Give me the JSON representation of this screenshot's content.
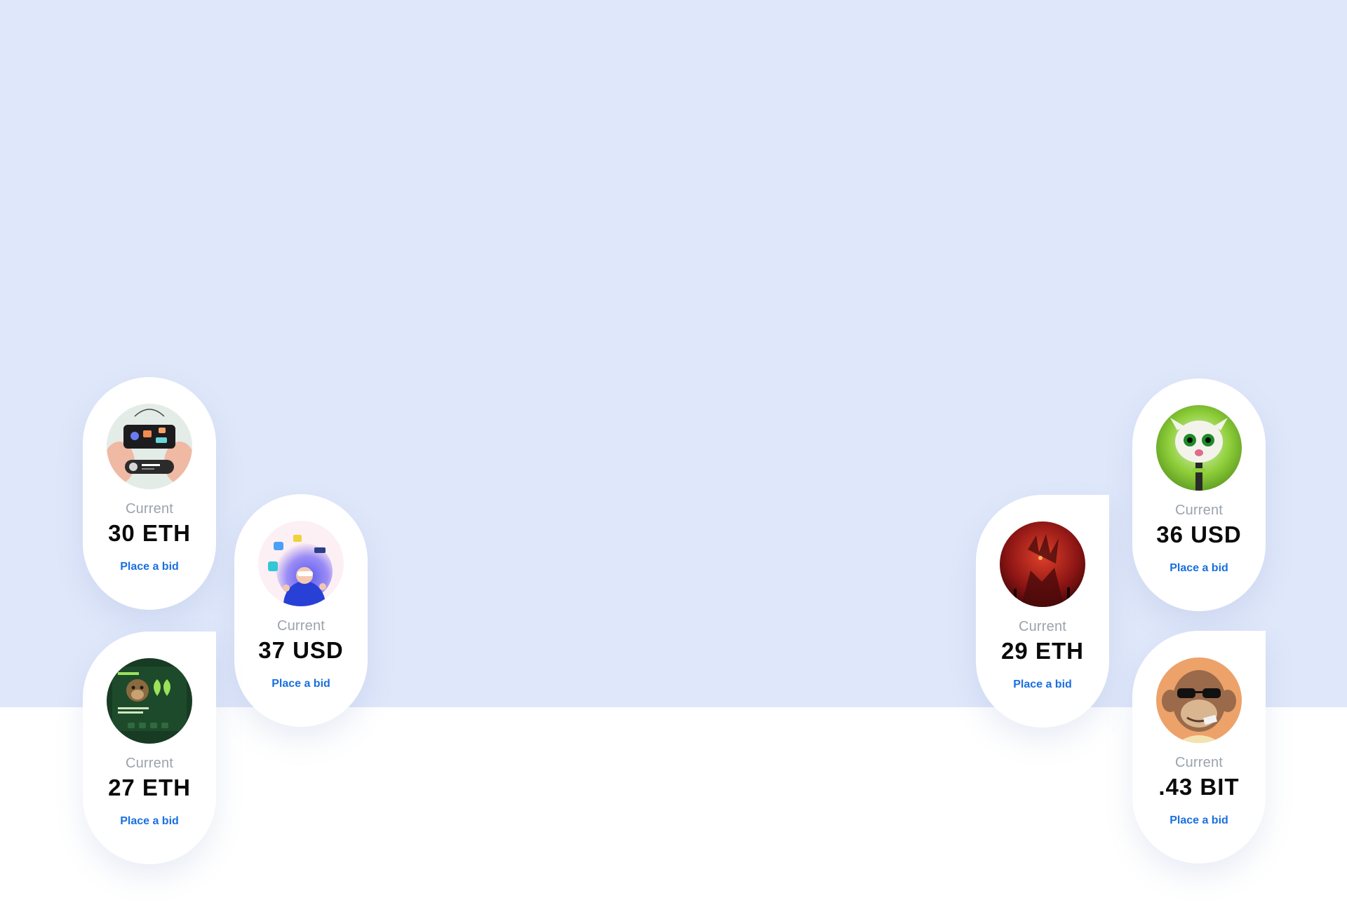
{
  "cards": [
    {
      "id": "card-1",
      "label": "Current",
      "price": "30 ETH",
      "action": "Place a bid",
      "art": "phone-app-art"
    },
    {
      "id": "card-2",
      "label": "Current",
      "price": "37 USD",
      "action": "Place a bid",
      "art": "vr-person-art"
    },
    {
      "id": "card-3",
      "label": "Current",
      "price": "27 ETH",
      "action": "Place a bid",
      "art": "ape-dashboard-art"
    },
    {
      "id": "card-4",
      "label": "Current",
      "price": "29 ETH",
      "action": "Place a bid",
      "art": "red-demon-art"
    },
    {
      "id": "card-5",
      "label": "Current",
      "price": "36 USD",
      "action": "Place a bid",
      "art": "green-creature-art"
    },
    {
      "id": "card-6",
      "label": "Current",
      "price": ".43 BIT",
      "action": "Place a bid",
      "art": "bored-ape-art"
    }
  ],
  "colors": {
    "hero_background": "#dfe7fa",
    "page_background": "#ffffff",
    "link_blue": "#1a6fe0",
    "label_gray": "#9aa3ae",
    "price_black": "#0a0a0a"
  }
}
